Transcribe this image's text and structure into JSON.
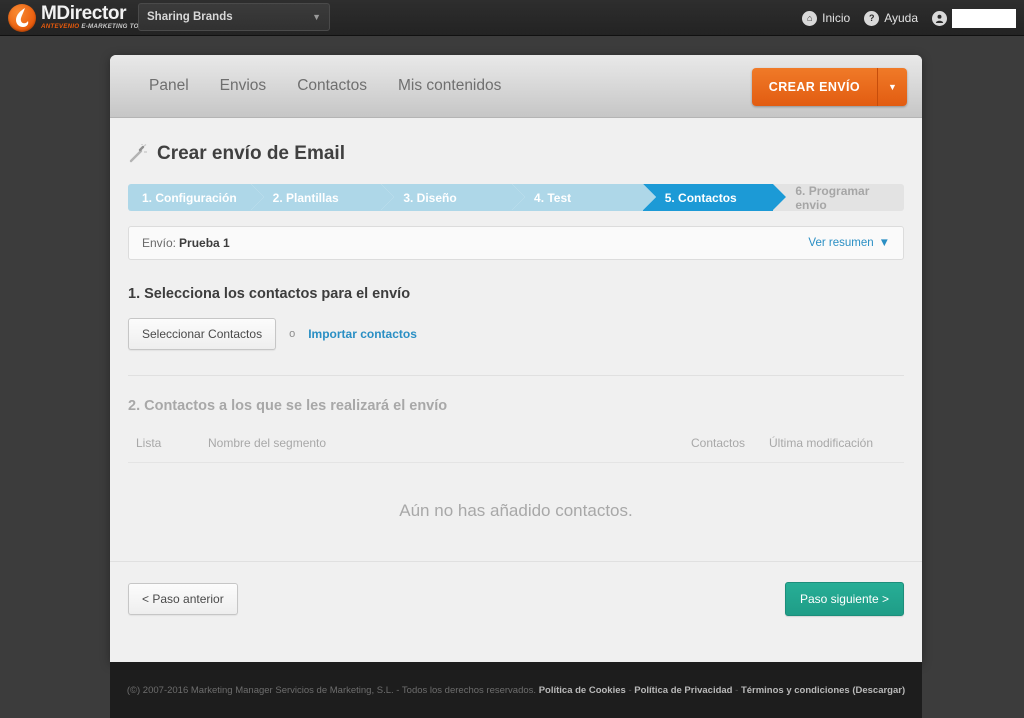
{
  "topbar": {
    "logo_name": "MDirector",
    "logo_tag_orange": "ANTEVENIO",
    "logo_tag_rest": "E-MARKETING TOOL",
    "brand_select_value": "Sharing Brands",
    "brand_select_caret": "▼",
    "nav": [
      {
        "label": "Inicio",
        "icon": "home-icon",
        "glyph": "⌂"
      },
      {
        "label": "Ayuda",
        "icon": "help-icon",
        "glyph": "?"
      }
    ],
    "user_icon": "user-avatar-icon",
    "user_glyph": "●",
    "user_name": ""
  },
  "appnav": {
    "links": [
      "Panel",
      "Envios",
      "Contactos",
      "Mis contenidos"
    ],
    "cta_label": "CREAR ENVÍO",
    "cta_caret": "▼"
  },
  "page": {
    "title": "Crear envío de Email",
    "title_icon": "magic-wand-icon"
  },
  "steps": [
    {
      "label": "1. Configuración",
      "state": "done"
    },
    {
      "label": "2. Plantillas",
      "state": "done"
    },
    {
      "label": "3. Diseño",
      "state": "done"
    },
    {
      "label": "4. Test",
      "state": "done"
    },
    {
      "label": "5. Contactos",
      "state": "active"
    },
    {
      "label": "6. Programar envio",
      "state": "inactive"
    }
  ],
  "summary": {
    "prefix": "Envío:",
    "name": "Prueba 1",
    "link": "Ver resumen",
    "caret": "▼"
  },
  "section1": {
    "title": "1. Selecciona los contactos para el envío",
    "select_button": "Seleccionar Contactos",
    "separator": "o",
    "import_link": "Importar contactos"
  },
  "section2": {
    "title": "2. Contactos a los que se les realizará el envío",
    "columns": [
      "Lista",
      "Nombre del segmento",
      "Contactos",
      "Última modificación"
    ],
    "rows": [],
    "empty_message": "Aún no has añadido contactos."
  },
  "wizard_footer": {
    "prev_label": "< Paso anterior",
    "next_label": "Paso siguiente >"
  },
  "sitefooter": {
    "copyright": "(©) 2007-2016 Marketing Manager Servicios de Marketing, S.L. - Todos los derechos reservados.",
    "link_cookies": "Política de Cookies",
    "sep1": "-",
    "link_privacy": "Política de Privacidad",
    "sep2": "-",
    "link_terms": "Términos y condiciones (Descargar)"
  },
  "colors": {
    "accent_orange": "#e25c11",
    "accent_blue": "#1c9ad6",
    "step_done_blue": "#aed7e8",
    "next_green": "#1f9d87",
    "dark_chrome": "#232323"
  }
}
